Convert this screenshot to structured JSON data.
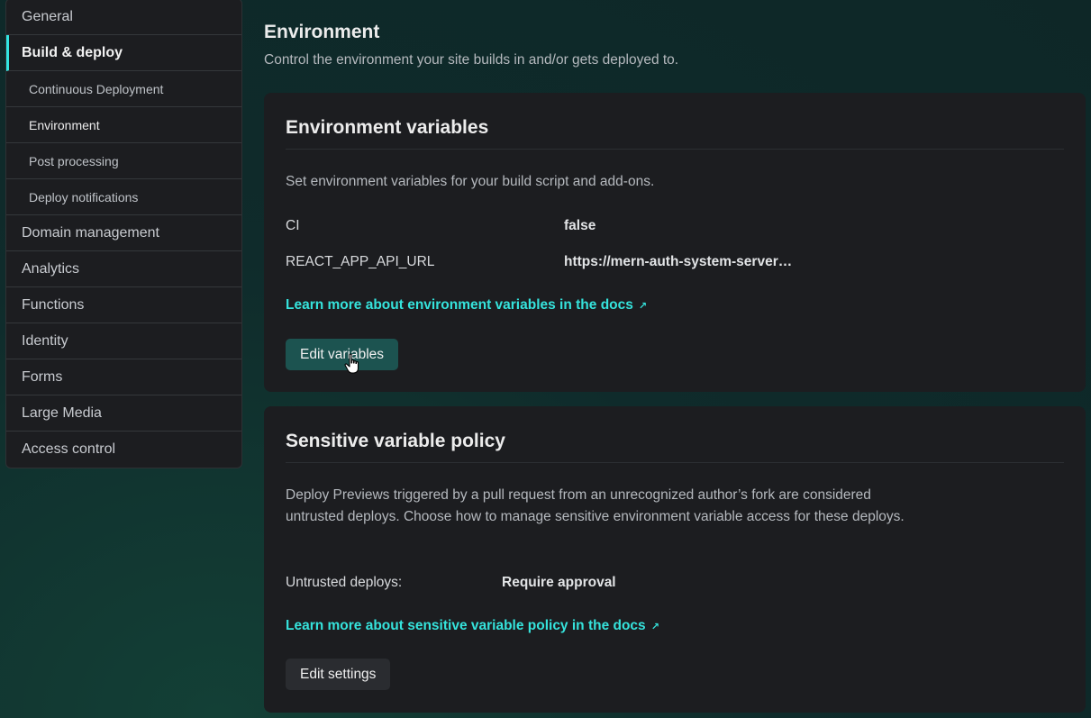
{
  "sidebar": {
    "items": [
      {
        "label": "General"
      },
      {
        "label": "Build & deploy"
      },
      {
        "label": "Continuous Deployment"
      },
      {
        "label": "Environment"
      },
      {
        "label": "Post processing"
      },
      {
        "label": "Deploy notifications"
      },
      {
        "label": "Domain management"
      },
      {
        "label": "Analytics"
      },
      {
        "label": "Functions"
      },
      {
        "label": "Identity"
      },
      {
        "label": "Forms"
      },
      {
        "label": "Large Media"
      },
      {
        "label": "Access control"
      }
    ]
  },
  "header": {
    "title": "Environment",
    "subtitle": "Control the environment your site builds in and/or gets deployed to."
  },
  "env_vars": {
    "title": "Environment variables",
    "description": "Set environment variables for your build script and add-ons.",
    "rows": [
      {
        "key": "CI",
        "value": "false"
      },
      {
        "key": "REACT_APP_API_URL",
        "value": "https://mern-auth-system-server…"
      }
    ],
    "link": "Learn more about environment variables in the docs",
    "button": "Edit variables"
  },
  "sensitive_policy": {
    "title": "Sensitive variable policy",
    "description": "Deploy Previews triggered by a pull request from an unrecognized author’s fork are considered untrusted deploys. Choose how to manage sensitive environment variable access for these deploys.",
    "setting_label": "Untrusted deploys:",
    "setting_value": "Require approval",
    "link": "Learn more about sensitive variable policy in the docs",
    "button": "Edit settings"
  },
  "icons": {
    "external_link": "external-link-icon",
    "cursor": "hand-pointer-cursor"
  },
  "colors": {
    "accent": "#35e3dc",
    "primary_button": "#1c5350",
    "card_bg": "#1c1d20",
    "page_bg": "#0f2a2a"
  }
}
